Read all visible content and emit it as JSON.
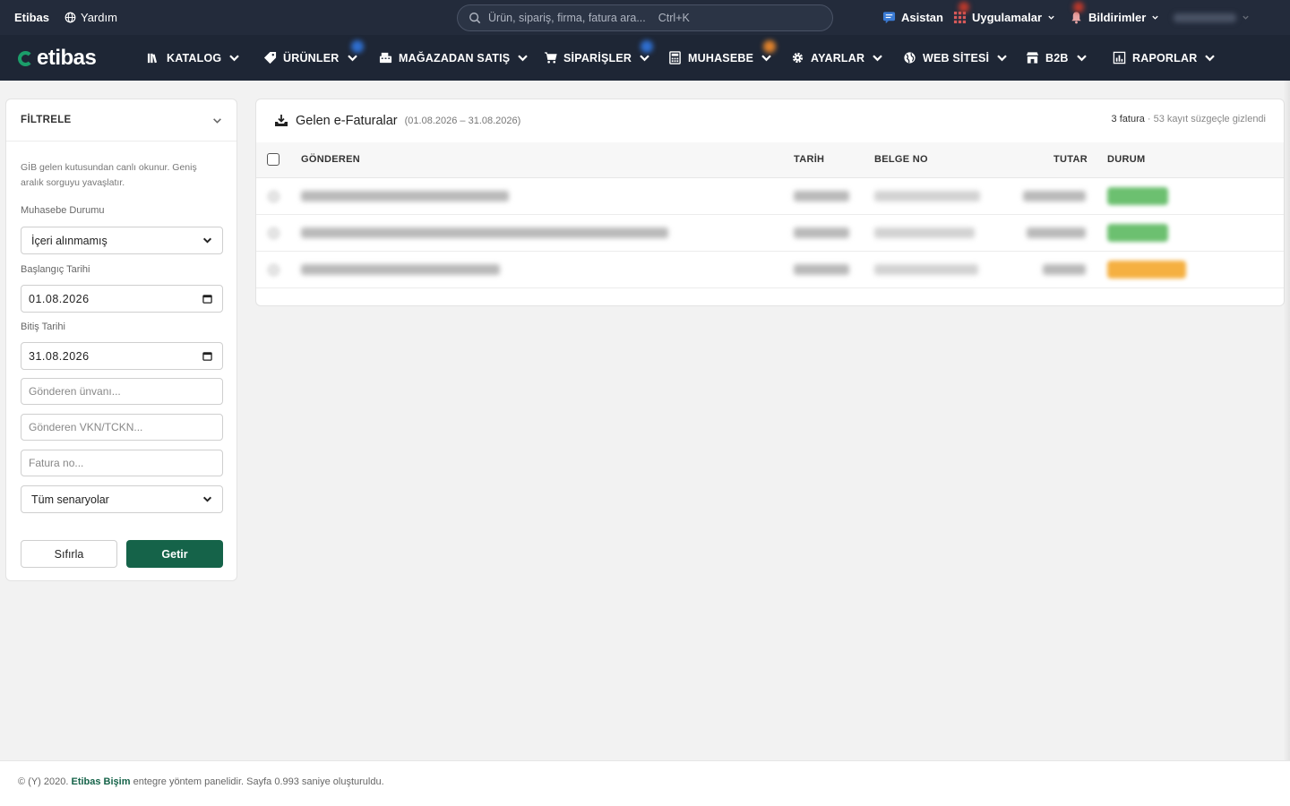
{
  "topbar": {
    "brand": "Etibas",
    "help": "Yardım",
    "search_placeholder": "Ürün, sipariş, firma, fatura ara...",
    "search_shortcut": "Ctrl+K",
    "assistant": "Asistan",
    "apps": "Uygulamalar",
    "notifications": "Bildirimler"
  },
  "nav": {
    "logo": "etibas",
    "items": [
      "KATALOG",
      "ÜRÜNLER",
      "MAĞAZADAN SATIŞ",
      "SİPARİŞLER",
      "MUHASEBE",
      "AYARLAR",
      "WEB SİTESİ",
      "B2B",
      "RAPORLAR"
    ]
  },
  "filter": {
    "title": "FİLTRELE",
    "note": "GİB gelen kutusundan canlı okunur. Geniş aralık sorguyu yavaşlatır.",
    "status_label": "Muhasebe Durumu",
    "status_value": "İçeri alınmamış",
    "start_label": "Başlangıç Tarihi",
    "start_value": "01.08.2026",
    "end_label": "Bitiş Tarihi",
    "end_value": "31.08.2026",
    "sender_placeholder": "Gönderen ünvanı...",
    "vkn_placeholder": "Gönderen VKN/TCKN...",
    "invoice_placeholder": "Fatura no...",
    "scenario_value": "Tüm senaryolar",
    "reset": "Sıfırla",
    "submit": "Getir"
  },
  "card": {
    "title": "Gelen e-Faturalar",
    "range": "(01.08.2026 – 31.08.2026)",
    "count": "3 fatura",
    "hidden": "· 53 kayıt süzgeçle gizlendi",
    "columns": [
      "GÖNDEREN",
      "TARİH",
      "BELGE NO",
      "TUTAR",
      "DURUM"
    ]
  },
  "colors": {
    "topbar": "#232b3b",
    "navbar": "#1e2635",
    "accent": "#156349",
    "status_ok": "#6cc070",
    "status_warn": "#f5b041"
  },
  "footer": {
    "prefix": "© (Y) 2020.",
    "company": "Etibas Bişim",
    "suffix": "entegre yöntem panelidir. Sayfa 0.993 saniye oluşturuldu."
  }
}
